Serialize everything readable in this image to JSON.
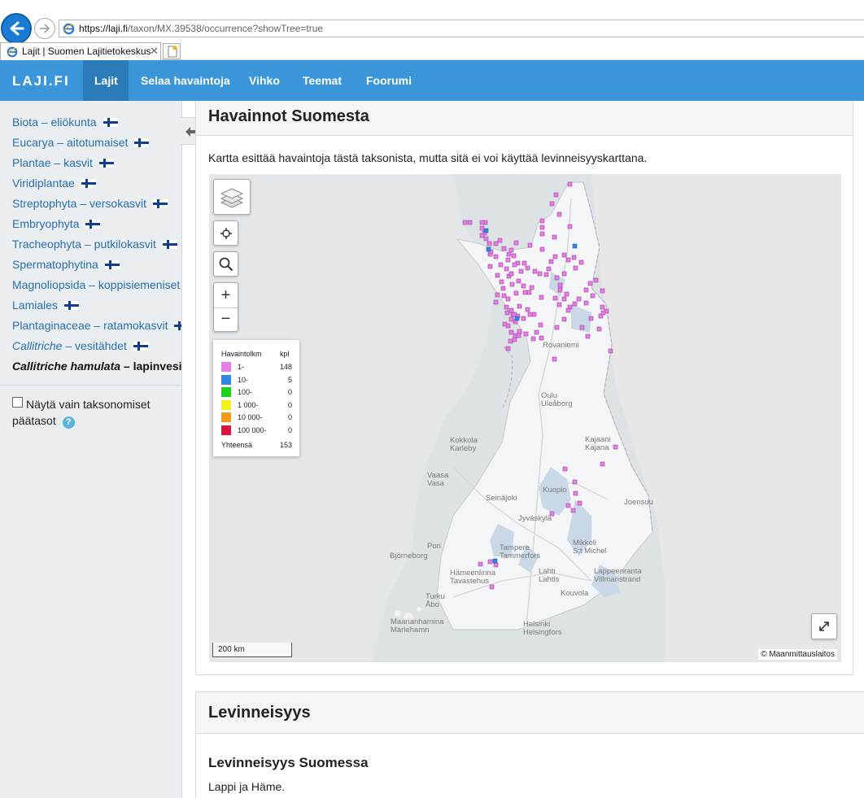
{
  "browser": {
    "url_domain": "https://laji.fi",
    "url_path": "/taxon/MX.39538/occurrence?showTree=true",
    "tab_title": "Lajit | Suomen Lajitietokeskus",
    "tab_close": "✕"
  },
  "nav": {
    "logo": "LAJI.FI",
    "items": [
      "Lajit",
      "Selaa havaintoja",
      "Vihko",
      "Teemat",
      "Foorumi"
    ],
    "active": "Lajit",
    "active_color": "#2a7bb8",
    "bar_color": "#3a96d8"
  },
  "sidebar": {
    "tree": [
      {
        "sci": "Biota",
        "sep": " – ",
        "vern": "eliökunta",
        "italic": false
      },
      {
        "sci": "Eucarya",
        "sep": " – ",
        "vern": "aitotumaiset",
        "italic": false
      },
      {
        "sci": "Plantae",
        "sep": " – ",
        "vern": "kasvit",
        "italic": false
      },
      {
        "sci": "Viridiplantae",
        "sep": "",
        "vern": "",
        "italic": false
      },
      {
        "sci": "Streptophyta",
        "sep": " – ",
        "vern": "versokasvit",
        "italic": false
      },
      {
        "sci": "Embryophyta",
        "sep": "",
        "vern": "",
        "italic": false
      },
      {
        "sci": "Tracheophyta",
        "sep": " – ",
        "vern": "putkilokasvit",
        "italic": false
      },
      {
        "sci": "Spermatophytina",
        "sep": "",
        "vern": "",
        "italic": false
      },
      {
        "sci": "Magnoliopsida",
        "sep": " – ",
        "vern": "koppisiemeniset",
        "italic": false
      },
      {
        "sci": "Lamiales",
        "sep": "",
        "vern": "",
        "italic": false
      },
      {
        "sci": "Plantaginaceae",
        "sep": " – ",
        "vern": "ratamokasvit",
        "italic": false
      },
      {
        "sci": "Callitriche",
        "sep": " – ",
        "vern": "vesitähdet",
        "italic": true
      },
      {
        "sci": "Callitriche hamulata",
        "sep": " – ",
        "vern": "lapinvesitähti",
        "italic": true,
        "current": true
      }
    ],
    "checkbox_label": "Näytä vain taksonomiset päätasot",
    "help": "?"
  },
  "observations": {
    "title": "Havainnot Suomesta",
    "description": "Kartta esittää havaintoja tästä taksonista, mutta sitä ei voi käyttää levinneisyyskarttana.",
    "zoom_in": "+",
    "zoom_out": "−",
    "scale_text": "200 km",
    "attribution": "© Maanmittauslaitos",
    "legend": {
      "header": "Havaintolkm",
      "unit": "kpl",
      "rows": [
        {
          "label": "1-",
          "count": "148",
          "color": "#e87ce8"
        },
        {
          "label": "10-",
          "count": "5",
          "color": "#2f86e6"
        },
        {
          "label": "100-",
          "count": "0",
          "color": "#1fd11f"
        },
        {
          "label": "1 000-",
          "count": "0",
          "color": "#f2f21a"
        },
        {
          "label": "10 000-",
          "count": "0",
          "color": "#f29b1a"
        },
        {
          "label": "100 000-",
          "count": "0",
          "color": "#dc143c"
        }
      ],
      "total_label": "Yhteensä",
      "total": "153"
    },
    "places": [
      {
        "name": "Rovaniemi"
      },
      {
        "name": "Oulu\nUleåborg"
      },
      {
        "name": "Kokkola\nKarleby"
      },
      {
        "name": "Kajaani\nKajana"
      },
      {
        "name": "Vaasa\nVasa"
      },
      {
        "name": "Seinäjoki"
      },
      {
        "name": "Kuopio"
      },
      {
        "name": "Joensuu"
      },
      {
        "name": "Jyväskylä"
      },
      {
        "name": "Pori"
      },
      {
        "name": "Björneborg"
      },
      {
        "name": "Tampere\nTammerfors"
      },
      {
        "name": "Mikkeli\nS:t Michel"
      },
      {
        "name": "Hämeenlinna\nTavastehus"
      },
      {
        "name": "Lahti\nLahtis"
      },
      {
        "name": "Lappeenranta\nVillmanstrand"
      },
      {
        "name": "Turku\nÅbo"
      },
      {
        "name": "Kouvola"
      },
      {
        "name": "Maarianhamina\nMariehamn"
      },
      {
        "name": "Helsinki\nHelsingfors"
      }
    ]
  },
  "distribution": {
    "title": "Levinneisyys",
    "subtitle": "Levinneisyys Suomessa",
    "text": "Lappi ja Häme."
  }
}
